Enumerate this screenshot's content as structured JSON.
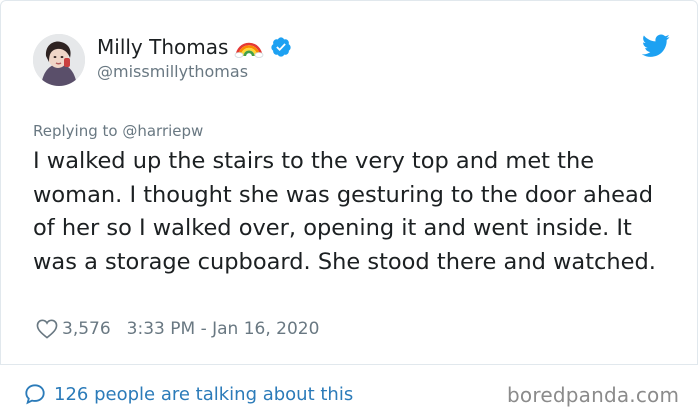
{
  "author": {
    "name": "Milly Thomas",
    "handle": "@missmillythomas",
    "badge_emoji_icon": "rainbow-icon",
    "verified_icon": "verified-badge-icon"
  },
  "reply": {
    "prefix": "Replying to",
    "mention": "@harriepw"
  },
  "tweet": {
    "text": "I walked up the stairs to the very top and met the woman. I thought she was gesturing to the door ahead of her so I walked over, opening it and went inside. It was a storage cupboard. She stood there and watched."
  },
  "meta": {
    "likes": "3,576",
    "timestamp": "3:33 PM - Jan 16, 2020"
  },
  "footer": {
    "talking": "126 people are talking about this"
  },
  "watermark": "boredpanda.com",
  "colors": {
    "twitter_blue": "#1da1f2",
    "link_blue": "#2b7bb9",
    "muted": "#697882",
    "text": "#1c2022"
  }
}
